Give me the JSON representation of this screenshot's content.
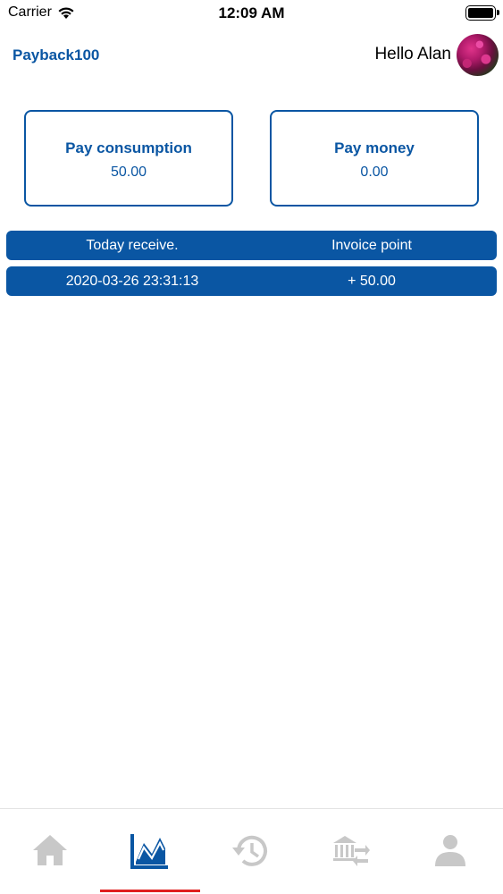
{
  "status_bar": {
    "carrier": "Carrier",
    "time": "12:09 AM"
  },
  "header": {
    "brand": "Payback100",
    "greeting": "Hello Alan"
  },
  "cards": [
    {
      "title": "Pay consumption",
      "value": "50.00"
    },
    {
      "title": "Pay money",
      "value": "0.00"
    }
  ],
  "table": {
    "headers": [
      "Today receive.",
      "Invoice point"
    ],
    "rows": [
      [
        "2020-03-26 23:31:13",
        "+ 50.00"
      ]
    ]
  },
  "tabbar": {
    "active_index": 1,
    "tabs": [
      {
        "icon": "home-icon"
      },
      {
        "icon": "chart-icon"
      },
      {
        "icon": "history-icon"
      },
      {
        "icon": "bank-transfer-icon"
      },
      {
        "icon": "profile-icon"
      }
    ]
  },
  "colors": {
    "accent": "#0a56a3",
    "indicator": "#e02020",
    "inactive_icon": "#c8c8c8"
  }
}
